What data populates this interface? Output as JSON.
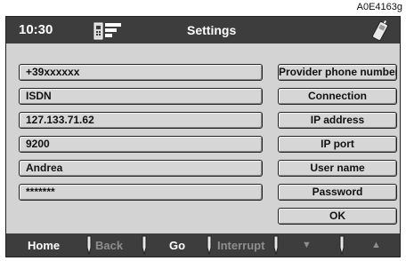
{
  "figure_ref": "A0E4163g",
  "header": {
    "time": "10:30",
    "title": "Settings"
  },
  "fields": [
    {
      "value": "+39xxxxxx"
    },
    {
      "value": "ISDN"
    },
    {
      "value": "127.133.71.62"
    },
    {
      "value": "9200"
    },
    {
      "value": "Andrea"
    },
    {
      "value": "*******"
    }
  ],
  "buttons": [
    {
      "label": "Provider phone number"
    },
    {
      "label": "Connection"
    },
    {
      "label": "IP address"
    },
    {
      "label": "IP port"
    },
    {
      "label": "User name"
    },
    {
      "label": "Password"
    },
    {
      "label": "OK"
    }
  ],
  "nav": {
    "home": "Home",
    "back": "Back",
    "go": "Go",
    "interrupt": "Interrupt",
    "down": "▼",
    "up": "▲"
  },
  "icons": [
    "phone-menu-icon",
    "handset-icon",
    "separator-icon"
  ],
  "colors": {
    "bar": "#3d3d3d",
    "screen": "#d3d3d3",
    "disabled_text": "#8e8e8e"
  }
}
